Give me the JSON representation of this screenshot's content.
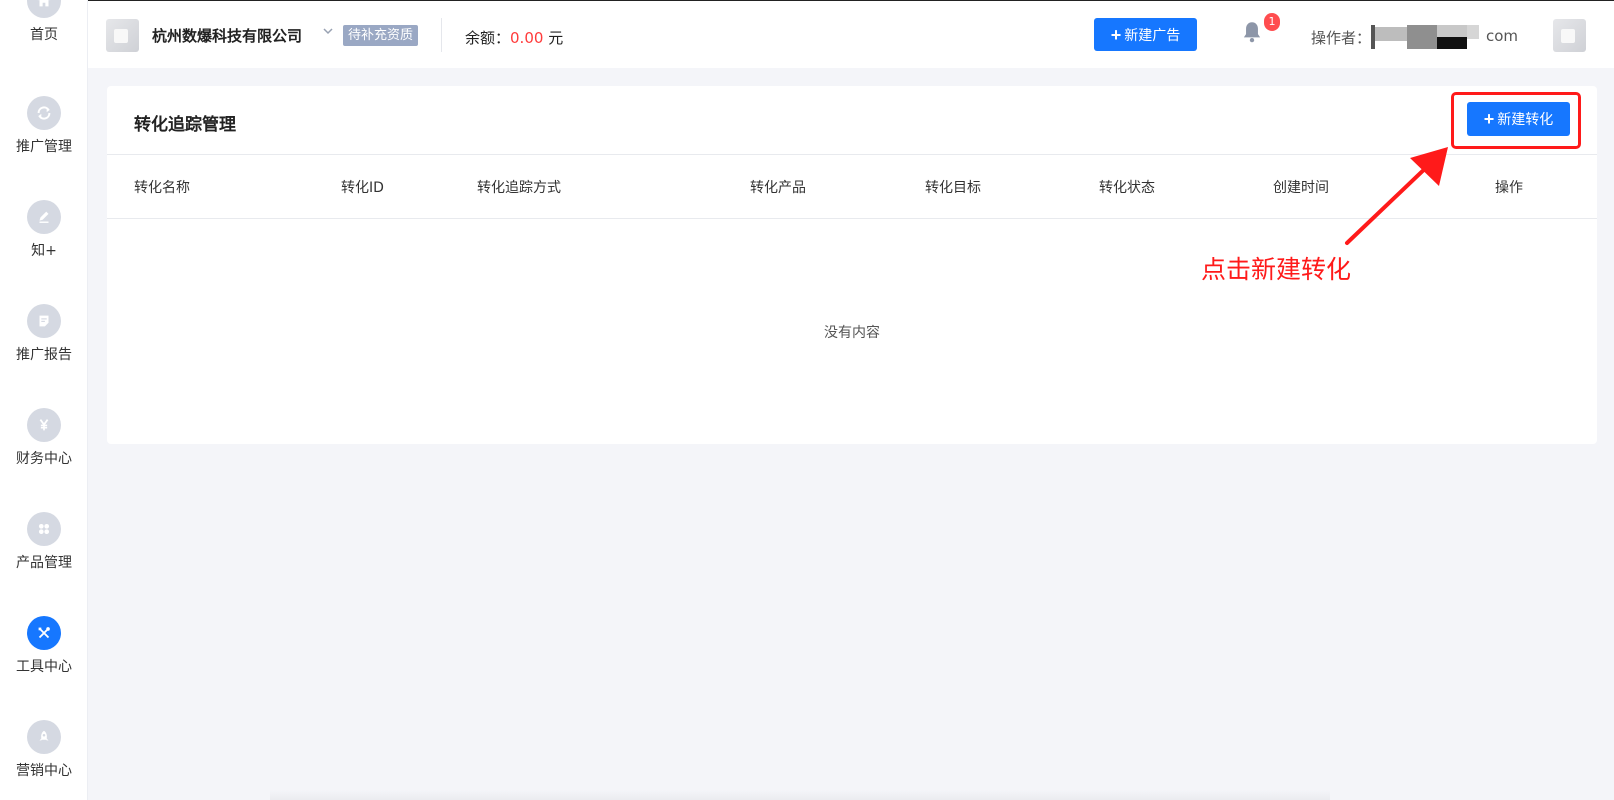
{
  "sidebar": {
    "items": [
      {
        "label": "首页",
        "icon": "home-icon",
        "active": false
      },
      {
        "label": "推广管理",
        "icon": "refresh-icon",
        "active": false
      },
      {
        "label": "知+",
        "icon": "pen-icon",
        "active": false
      },
      {
        "label": "推广报告",
        "icon": "report-icon",
        "active": false
      },
      {
        "label": "财务中心",
        "icon": "yuan-icon",
        "active": false
      },
      {
        "label": "产品管理",
        "icon": "grid-icon",
        "active": false
      },
      {
        "label": "工具中心",
        "icon": "tools-icon",
        "active": true
      },
      {
        "label": "营销中心",
        "icon": "rocket-icon",
        "active": false
      }
    ]
  },
  "header": {
    "company": "杭州数爆科技有限公司",
    "qualification_status": "待补充资质",
    "balance_label": "余额：",
    "balance_amount": "0.00",
    "balance_unit": "元",
    "new_ad_label": "新建广告",
    "notification_count": "1",
    "operator_label": "操作者：",
    "operator_suffix": "com"
  },
  "main": {
    "title": "转化追踪管理",
    "new_conversion_label": "新建转化",
    "columns": [
      "转化名称",
      "转化ID",
      "转化追踪方式",
      "转化产品",
      "转化目标",
      "转化状态",
      "创建时间",
      "操作"
    ],
    "empty_text": "没有内容"
  },
  "annotation": {
    "text": "点击新建转化",
    "color": "#ff1a1a"
  },
  "colors": {
    "primary": "#1677ff",
    "badge": "#9aa8c4",
    "amount": "#ff3b3b"
  }
}
